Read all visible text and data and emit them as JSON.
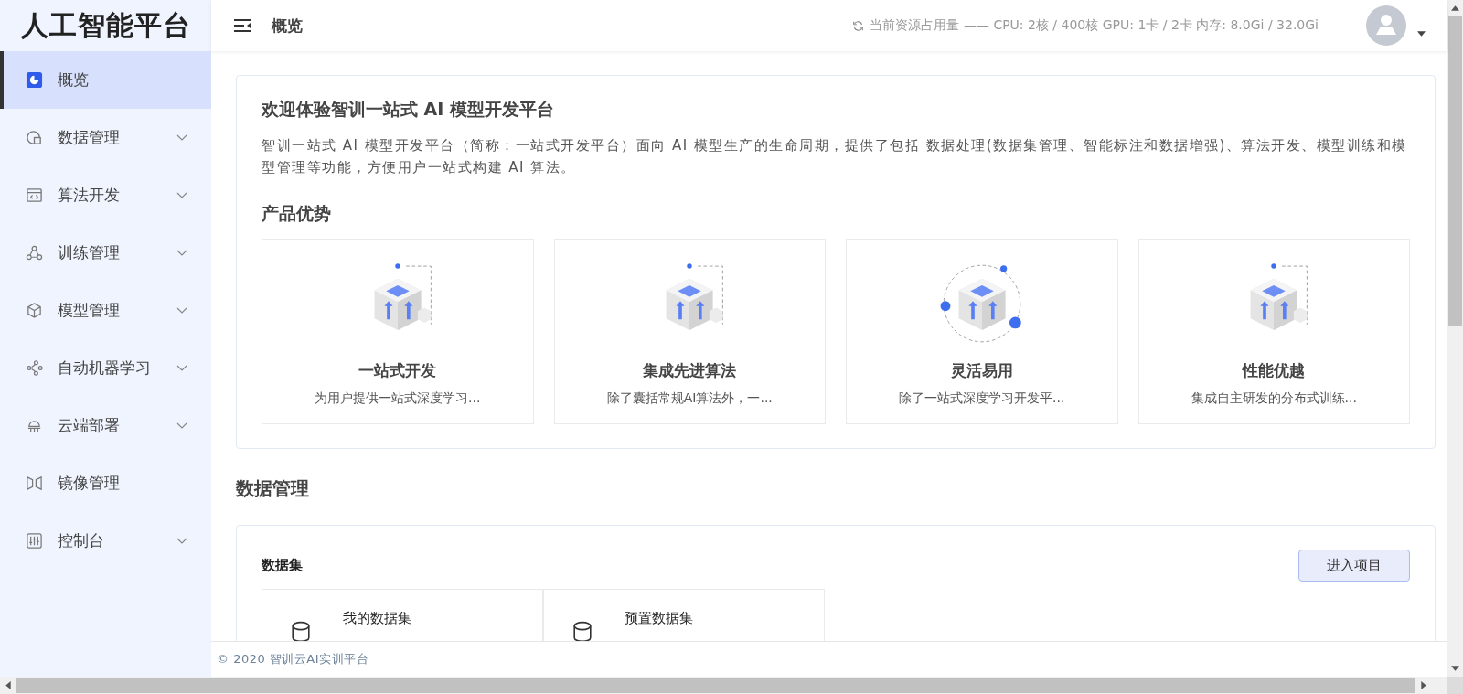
{
  "sidebar": {
    "logo": "人工智能平台",
    "items": [
      {
        "label": "概览",
        "selected": true,
        "expandable": false
      },
      {
        "label": "数据管理",
        "selected": false,
        "expandable": true
      },
      {
        "label": "算法开发",
        "selected": false,
        "expandable": true
      },
      {
        "label": "训练管理",
        "selected": false,
        "expandable": true
      },
      {
        "label": "模型管理",
        "selected": false,
        "expandable": true
      },
      {
        "label": "自动机器学习",
        "selected": false,
        "expandable": true
      },
      {
        "label": "云端部署",
        "selected": false,
        "expandable": true
      },
      {
        "label": "镜像管理",
        "selected": false,
        "expandable": false
      },
      {
        "label": "控制台",
        "selected": false,
        "expandable": true
      }
    ]
  },
  "header": {
    "title": "概览",
    "resource_usage": "当前资源占用量 —— CPU: 2核 / 400核 GPU: 1卡 / 2卡 内存: 8.0Gi / 32.0Gi"
  },
  "welcome": {
    "title": "欢迎体验智训一站式 AI 模型开发平台",
    "description": "智训一站式 AI 模型开发平台（简称：一站式开发平台）面向 AI 模型生产的生命周期，提供了包括 数据处理(数据集管理、智能标注和数据增强)、算法开发、模型训练和模型管理等功能，方便用户一站式构建 AI 算法。",
    "advantages_title": "产品优势",
    "features": [
      {
        "title": "一站式开发",
        "description": "为用户提供一站式深度学习..."
      },
      {
        "title": "集成先进算法",
        "description": "除了囊括常规AI算法外，一..."
      },
      {
        "title": "灵活易用",
        "description": "除了一站式深度学习开发平..."
      },
      {
        "title": "性能优越",
        "description": "集成自主研发的分布式训练..."
      }
    ]
  },
  "data_management": {
    "heading": "数据管理",
    "card_title": "数据集",
    "button": "进入项目",
    "tiles": [
      {
        "title": "我的数据集"
      },
      {
        "title": "预置数据集"
      }
    ]
  },
  "footer": "© 2020 智训云AI实训平台"
}
